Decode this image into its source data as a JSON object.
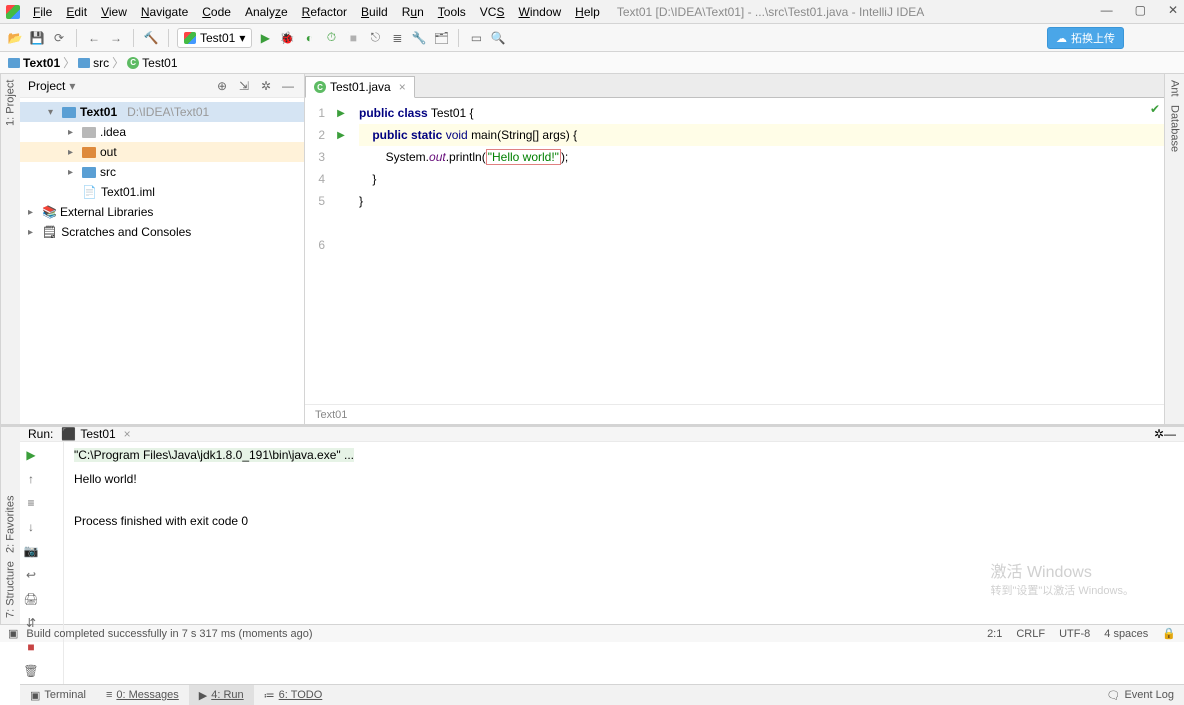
{
  "window": {
    "title": "Text01 [D:\\IDEA\\Text01] - ...\\src\\Test01.java - IntelliJ IDEA"
  },
  "menu": {
    "file": "File",
    "edit": "Edit",
    "view": "View",
    "navigate": "Navigate",
    "code": "Code",
    "analyze": "Analyze",
    "refactor": "Refactor",
    "build": "Build",
    "run": "Run",
    "tools": "Tools",
    "vcs": "VCS",
    "window": "Window",
    "help": "Help"
  },
  "run_config": {
    "selected": "Test01"
  },
  "upload_btn": "拓换上传",
  "breadcrumb": {
    "proj": "Text01",
    "src": "src",
    "file": "Test01"
  },
  "project_panel": {
    "title": "Project",
    "root": {
      "name": "Text01",
      "path": "D:\\IDEA\\Text01"
    },
    "idea": ".idea",
    "out": "out",
    "src": "src",
    "iml": "Text01.iml",
    "ext": "External Libraries",
    "scratch": "Scratches and Consoles"
  },
  "tab": {
    "name": "Test01.java"
  },
  "code": {
    "l1": "public class Test01 {",
    "l2": "    public static void main(String[] args) {",
    "l3_pre": "        System.out.println(",
    "l3_str": "\"Hello world!\"",
    "l3_post": ");",
    "l4": "    }",
    "l5": "}",
    "breadcrumb": "Text01"
  },
  "run_panel": {
    "title": "Run:",
    "tab": "Test01",
    "cmd": "\"C:\\Program Files\\Java\\jdk1.8.0_191\\bin\\java.exe\" ...",
    "out": "Hello world!",
    "exit": "Process finished with exit code 0"
  },
  "bottom_tabs": {
    "terminal": "Terminal",
    "messages": "0: Messages",
    "run": "4: Run",
    "todo": "6: TODO",
    "eventlog": "Event Log"
  },
  "status": {
    "msg": "Build completed successfully in 7 s 317 ms (moments ago)",
    "pos": "2:1",
    "eol": "CRLF",
    "enc": "UTF-8",
    "indent": "4 spaces"
  },
  "side_tabs": {
    "project": "1: Project",
    "favorites": "2: Favorites",
    "structure": "7: Structure",
    "ant": "Ant",
    "database": "Database"
  },
  "watermark": {
    "line1": "激活 Windows",
    "line2": "转到\"设置\"以激活 Windows。"
  }
}
